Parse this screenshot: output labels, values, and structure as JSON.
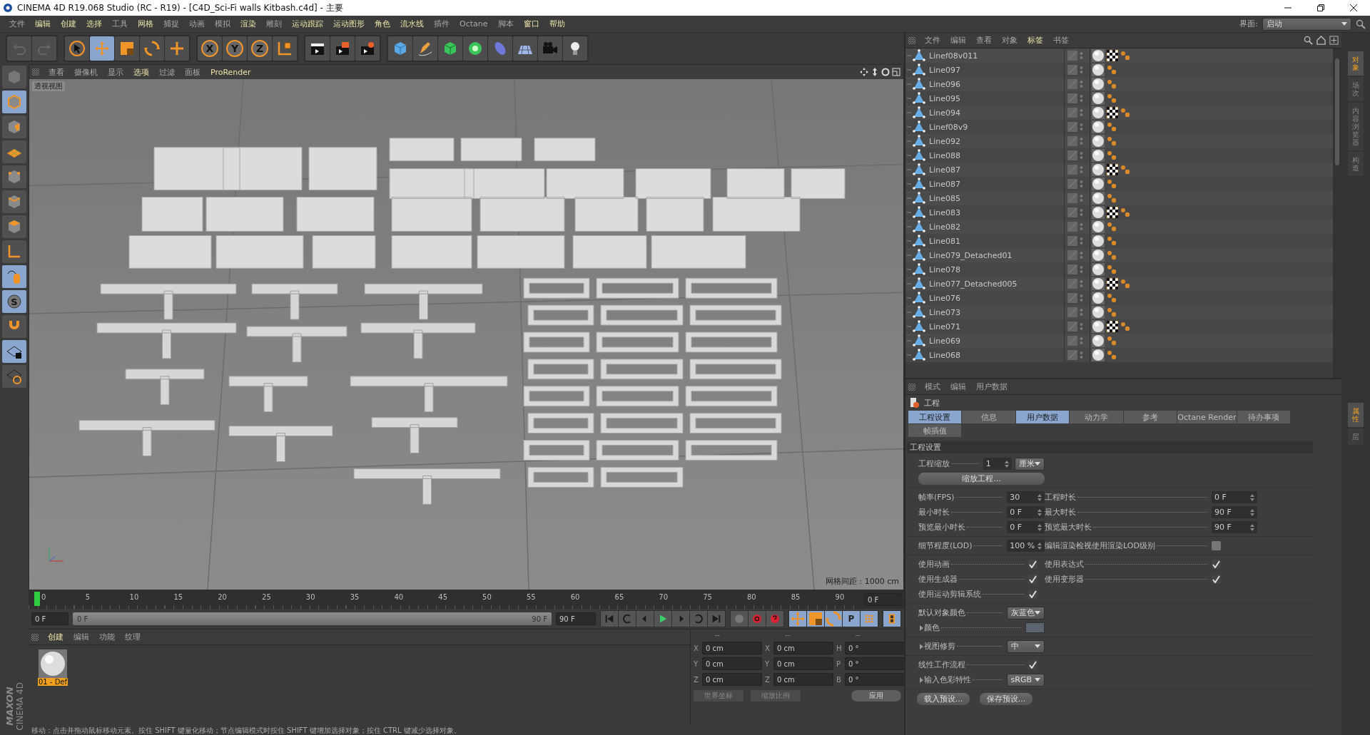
{
  "window": {
    "title": "CINEMA 4D R19.068 Studio (RC - R19) - [C4D_Sci-Fi walls Kitbash.c4d] - 主要"
  },
  "menu_bar": [
    {
      "label": "文件",
      "highlighted": false
    },
    {
      "label": "编辑",
      "highlighted": true
    },
    {
      "label": "创建",
      "highlighted": true
    },
    {
      "label": "选择",
      "highlighted": true
    },
    {
      "label": "工具",
      "highlighted": false
    },
    {
      "label": "网格",
      "highlighted": true
    },
    {
      "label": "捕捉",
      "highlighted": false
    },
    {
      "label": "动画",
      "highlighted": false
    },
    {
      "label": "模拟",
      "highlighted": false
    },
    {
      "label": "渲染",
      "highlighted": true
    },
    {
      "label": "雕刻",
      "highlighted": false
    },
    {
      "label": "运动跟踪",
      "highlighted": true
    },
    {
      "label": "运动图形",
      "highlighted": true
    },
    {
      "label": "角色",
      "highlighted": true
    },
    {
      "label": "流水线",
      "highlighted": true
    },
    {
      "label": "插件",
      "highlighted": false
    },
    {
      "label": "Octane",
      "highlighted": false
    },
    {
      "label": "脚本",
      "highlighted": false
    },
    {
      "label": "窗口",
      "highlighted": true
    },
    {
      "label": "帮助",
      "highlighted": true
    }
  ],
  "layout_selector": {
    "label": "界面:",
    "value": "启动"
  },
  "toolbar": [
    [
      {
        "kind": "undo",
        "selected": false
      },
      {
        "kind": "redo",
        "selected": false
      }
    ],
    [
      {
        "kind": "select",
        "selected": false
      },
      {
        "kind": "move",
        "selected": true
      },
      {
        "kind": "scale",
        "selected": false
      },
      {
        "kind": "rotate",
        "selected": false
      },
      {
        "kind": "add",
        "selected": false
      }
    ],
    [
      {
        "kind": "axis",
        "label": "X",
        "selected": false
      },
      {
        "kind": "axis",
        "label": "Y",
        "selected": false
      },
      {
        "kind": "axis",
        "label": "Z",
        "selected": false
      },
      {
        "kind": "coord",
        "selected": false
      }
    ],
    [
      {
        "kind": "render-view",
        "selected": false
      },
      {
        "kind": "render-picture",
        "selected": false
      },
      {
        "kind": "render-settings",
        "selected": false
      }
    ],
    [
      {
        "kind": "cube",
        "selected": false
      },
      {
        "kind": "pen",
        "selected": false
      },
      {
        "kind": "green-cube",
        "selected": false
      },
      {
        "kind": "cloner",
        "selected": false
      },
      {
        "kind": "deformer",
        "selected": false
      },
      {
        "kind": "floor",
        "selected": false
      },
      {
        "kind": "camera",
        "selected": false
      },
      {
        "kind": "light",
        "selected": false
      }
    ]
  ],
  "mode_strip": [
    {
      "kind": "ghost",
      "selected": false
    },
    {
      "kind": "model",
      "selected": true
    },
    {
      "kind": "texture",
      "selected": false
    },
    {
      "kind": "workplane",
      "selected": false
    },
    {
      "kind": "points",
      "selected": false
    },
    {
      "kind": "edges",
      "selected": false
    },
    {
      "kind": "polygons",
      "selected": false
    },
    {
      "kind": "axis",
      "selected": false
    },
    {
      "kind": "tweak",
      "selected": true
    },
    {
      "kind": "solo",
      "label": "S",
      "selected": true
    },
    {
      "kind": "snap",
      "selected": false
    },
    {
      "kind": "lock",
      "selected": true
    },
    {
      "kind": "cycle",
      "selected": false
    }
  ],
  "viewport": {
    "menu": [
      {
        "label": "查看",
        "highlighted": false
      },
      {
        "label": "摄像机",
        "highlighted": false
      },
      {
        "label": "显示",
        "highlighted": false
      },
      {
        "label": "选项",
        "highlighted": true
      },
      {
        "label": "过滤",
        "highlighted": false
      },
      {
        "label": "面板",
        "highlighted": false
      },
      {
        "label": "ProRender",
        "highlighted": true
      }
    ],
    "view_name": "透视视图",
    "grid_spacing": "网格间距 : 1000 cm"
  },
  "timeline": {
    "ticks": [
      "0",
      "5",
      "10",
      "15",
      "20",
      "25",
      "30",
      "35",
      "40",
      "45",
      "50",
      "55",
      "60",
      "65",
      "70",
      "75",
      "80",
      "85",
      "90"
    ],
    "playhead": {
      "level": 0
    },
    "current": "0 F"
  },
  "transport": {
    "start": "0 F",
    "range": {
      "start": "0 F",
      "end": "90 F",
      "level": 1
    },
    "end": "90 F",
    "buttons": [
      [
        {
          "kind": "first"
        },
        {
          "kind": "prev-key"
        },
        {
          "kind": "prev"
        },
        {
          "kind": "play"
        },
        {
          "kind": "next"
        },
        {
          "kind": "next-key"
        },
        {
          "kind": "last"
        }
      ],
      [
        {
          "kind": "record-off"
        },
        {
          "kind": "record"
        },
        {
          "kind": "help-record"
        }
      ],
      [
        {
          "kind": "move"
        },
        {
          "kind": "scale"
        },
        {
          "kind": "rotate"
        },
        {
          "kind": "param",
          "label": "P"
        },
        {
          "kind": "grid"
        }
      ],
      [
        {
          "kind": "timeline"
        }
      ]
    ]
  },
  "material_manager": {
    "menu": [
      {
        "label": "创建",
        "highlighted": true
      },
      {
        "label": "编辑",
        "highlighted": false
      },
      {
        "label": "功能",
        "highlighted": false
      },
      {
        "label": "纹理",
        "highlighted": false
      }
    ],
    "materials": [
      {
        "name": "01 - Def",
        "selected": true
      }
    ]
  },
  "logo": {
    "brand": "MAXON",
    "product": "CINEMA 4D"
  },
  "coordinates": {
    "headers": [
      "--",
      "--",
      "--"
    ],
    "rows": [
      {
        "axes": [
          "X",
          "X",
          "H"
        ],
        "values": [
          "0 cm",
          "0 cm",
          "0 °"
        ]
      },
      {
        "axes": [
          "Y",
          "Y",
          "P"
        ],
        "values": [
          "0 cm",
          "0 cm",
          "0 °"
        ]
      },
      {
        "axes": [
          "Z",
          "Z",
          "B"
        ],
        "values": [
          "0 cm",
          "0 cm",
          "0 °"
        ]
      }
    ],
    "modes": [
      "世界坐标",
      "缩放比例"
    ],
    "apply": "应用"
  },
  "status_bar": "移动：点击并拖动鼠标移动元素。按住 SHIFT 键量化移动；节点编辑模式时按住 SHIFT 键增加选择对象；按住 CTRL 键减少选择对象。",
  "object_manager": {
    "menu": [
      {
        "label": "文件",
        "highlighted": false
      },
      {
        "label": "编辑",
        "highlighted": false
      },
      {
        "label": "查看",
        "highlighted": false
      },
      {
        "label": "对象",
        "highlighted": false
      },
      {
        "label": "标签",
        "highlighted": true
      },
      {
        "label": "书签",
        "highlighted": false
      }
    ],
    "objects": [
      {
        "name": "Linef08v011",
        "texture_tag": true
      },
      {
        "name": "Line097",
        "texture_tag": false
      },
      {
        "name": "Line096",
        "texture_tag": false
      },
      {
        "name": "Line095",
        "texture_tag": false
      },
      {
        "name": "Line094",
        "texture_tag": true
      },
      {
        "name": "Linef08v9",
        "texture_tag": false
      },
      {
        "name": "Line092",
        "texture_tag": false
      },
      {
        "name": "Line088",
        "texture_tag": false
      },
      {
        "name": "Line087",
        "texture_tag": true
      },
      {
        "name": "Line087",
        "texture_tag": false
      },
      {
        "name": "Line085",
        "texture_tag": false
      },
      {
        "name": "Line083",
        "texture_tag": true
      },
      {
        "name": "Line082",
        "texture_tag": false
      },
      {
        "name": "Line081",
        "texture_tag": false
      },
      {
        "name": "Line079_Detached01",
        "texture_tag": false
      },
      {
        "name": "Line078",
        "texture_tag": false
      },
      {
        "name": "Line077_Detached005",
        "texture_tag": true
      },
      {
        "name": "Line076",
        "texture_tag": false
      },
      {
        "name": "Line073",
        "texture_tag": false
      },
      {
        "name": "Line071",
        "texture_tag": true
      },
      {
        "name": "Line069",
        "texture_tag": false
      },
      {
        "name": "Line068",
        "texture_tag": false
      }
    ]
  },
  "side_tabs_top": [
    {
      "label": "对象",
      "selected": true
    },
    {
      "label": "场次",
      "selected": false
    },
    {
      "label": "内容浏览器",
      "selected": false
    },
    {
      "label": "构造",
      "selected": false
    }
  ],
  "side_tabs_bottom": [
    {
      "label": "属性",
      "selected": true
    },
    {
      "label": "层",
      "selected": false
    }
  ],
  "attributes": {
    "menu": [
      {
        "label": "模式",
        "highlighted": false
      },
      {
        "label": "编辑",
        "highlighted": false
      },
      {
        "label": "用户数据",
        "highlighted": false
      }
    ],
    "header": "工程",
    "tabs": [
      {
        "label": "工程设置",
        "selected": true
      },
      {
        "label": "信息",
        "selected": false
      },
      {
        "label": "用户数据",
        "selected": true
      },
      {
        "label": "动力学",
        "selected": false
      },
      {
        "label": "参考",
        "selected": false
      },
      {
        "label": "Octane Render",
        "selected": false
      },
      {
        "label": "待办事项",
        "selected": false
      },
      {
        "label": "帧插值",
        "selected": false
      }
    ],
    "section": "工程设置",
    "groups": [
      [
        {
          "left": [
            {
              "label": "工程缩放",
              "kind": "number",
              "value": "1"
            },
            {
              "kind": "dropdown",
              "value": "厘米"
            }
          ]
        },
        {
          "left": [
            {
              "kind": "button",
              "label": "缩放工程..."
            }
          ]
        }
      ],
      [
        {
          "left": [
            {
              "label": "帧率(FPS)",
              "kind": "number",
              "value": "30"
            }
          ],
          "right": [
            {
              "label": "工程时长",
              "kind": "number",
              "value": "0 F"
            }
          ]
        },
        {
          "left": [
            {
              "label": "最小时长",
              "kind": "number",
              "value": "0 F"
            }
          ],
          "right": [
            {
              "label": "最大时长",
              "kind": "number",
              "value": "90 F"
            }
          ]
        },
        {
          "left": [
            {
              "label": "预览最小时长",
              "kind": "number",
              "value": "0 F"
            }
          ],
          "right": [
            {
              "label": "预览最大时长",
              "kind": "number",
              "value": "90 F"
            }
          ]
        }
      ],
      [
        {
          "left": [
            {
              "label": "细节程度(LOD)",
              "kind": "number",
              "value": "100 %"
            }
          ],
          "right": [
            {
              "label": "编辑渲染检视使用渲染LOD级别",
              "kind": "check",
              "checked": false
            }
          ]
        }
      ],
      [
        {
          "left": [
            {
              "label": "使用动画",
              "kind": "check",
              "checked": true
            }
          ],
          "right": [
            {
              "label": "使用表达式",
              "kind": "check",
              "checked": true
            }
          ]
        },
        {
          "left": [
            {
              "label": "使用生成器",
              "kind": "check",
              "checked": true
            }
          ],
          "right": [
            {
              "label": "使用变形器",
              "kind": "check",
              "checked": true
            }
          ]
        },
        {
          "left": [
            {
              "label": "使用运动剪辑系统",
              "kind": "check",
              "checked": true
            }
          ]
        }
      ],
      [
        {
          "left": [
            {
              "label": "默认对象颜色",
              "kind": "dropdown",
              "value": "灰蓝色"
            }
          ]
        },
        {
          "left": [
            {
              "label": "颜色",
              "kind": "color",
              "color": "#5d6570",
              "expanded": false
            }
          ]
        }
      ],
      [
        {
          "left": [
            {
              "label": "视图修剪",
              "kind": "dropdown",
              "value": "中",
              "expanded": false
            }
          ]
        }
      ],
      [
        {
          "left": [
            {
              "label": "线性工作流程",
              "kind": "check",
              "checked": true
            }
          ]
        },
        {
          "left": [
            {
              "label": "输入色彩特性",
              "kind": "dropdown",
              "value": "sRGB",
              "expanded": false
            }
          ]
        }
      ]
    ],
    "presets": [
      "载入预设...",
      "保存预设..."
    ]
  }
}
